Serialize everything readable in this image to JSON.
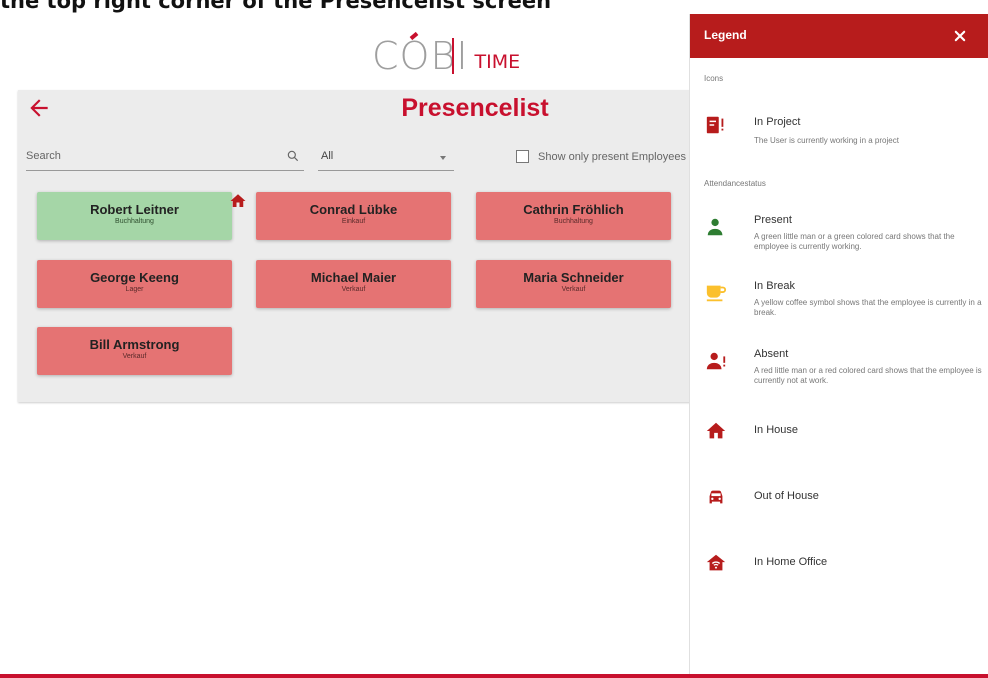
{
  "doc": {
    "heading": "the top right corner of the Presencelist screen"
  },
  "app": {
    "logo_main": "COBI",
    "logo_sub": "TIME",
    "brand_color": "#c8102e"
  },
  "page": {
    "title": "Presencelist",
    "back_icon": "arrow-left-icon"
  },
  "filters": {
    "search_placeholder": "Search",
    "select_value": "All",
    "checkbox_label": "Show only present Employees",
    "checkbox_checked": false
  },
  "employees": [
    {
      "name": "Robert Leitner",
      "department": "Buchhaltung",
      "status": "present"
    },
    {
      "name": "Conrad Lübke",
      "department": "Einkauf",
      "status": "absent"
    },
    {
      "name": "Cathrin Fröhlich",
      "department": "Buchhaltung",
      "status": "absent"
    },
    {
      "name": "George Keeng",
      "department": "Lager",
      "status": "absent"
    },
    {
      "name": "Michael Maier",
      "department": "Verkauf",
      "status": "absent"
    },
    {
      "name": "Maria Schneider",
      "department": "Verkauf",
      "status": "absent"
    },
    {
      "name": "Bill Armstrong",
      "department": "Verkauf",
      "status": "absent"
    }
  ],
  "legend": {
    "title": "Legend",
    "close_icon": "close-icon",
    "icons_section": "Icons",
    "attendance_section": "Attendancestatus",
    "in_project": {
      "title": "In Project",
      "desc": "The User is currently working in a project",
      "icon": "project-icon"
    },
    "present": {
      "title": "Present",
      "desc": "A green little man or a green colored card shows that the employee is currently working.",
      "icon": "person-icon",
      "color": "#2e7d32"
    },
    "in_break": {
      "title": "In Break",
      "desc": "A yellow coffee symbol shows that the employee is currently in a break.",
      "icon": "coffee-icon",
      "color": "#fbc02d"
    },
    "absent": {
      "title": "Absent",
      "desc": "A red little man or a red colored card shows that the employee is currently not at work.",
      "icon": "person-absent-icon",
      "color": "#b71c1c"
    },
    "in_house": {
      "title": "In House",
      "icon": "house-icon"
    },
    "out_of_house": {
      "title": "Out of House",
      "icon": "car-icon"
    },
    "home_office": {
      "title": "In Home Office",
      "icon": "home-office-icon"
    }
  }
}
